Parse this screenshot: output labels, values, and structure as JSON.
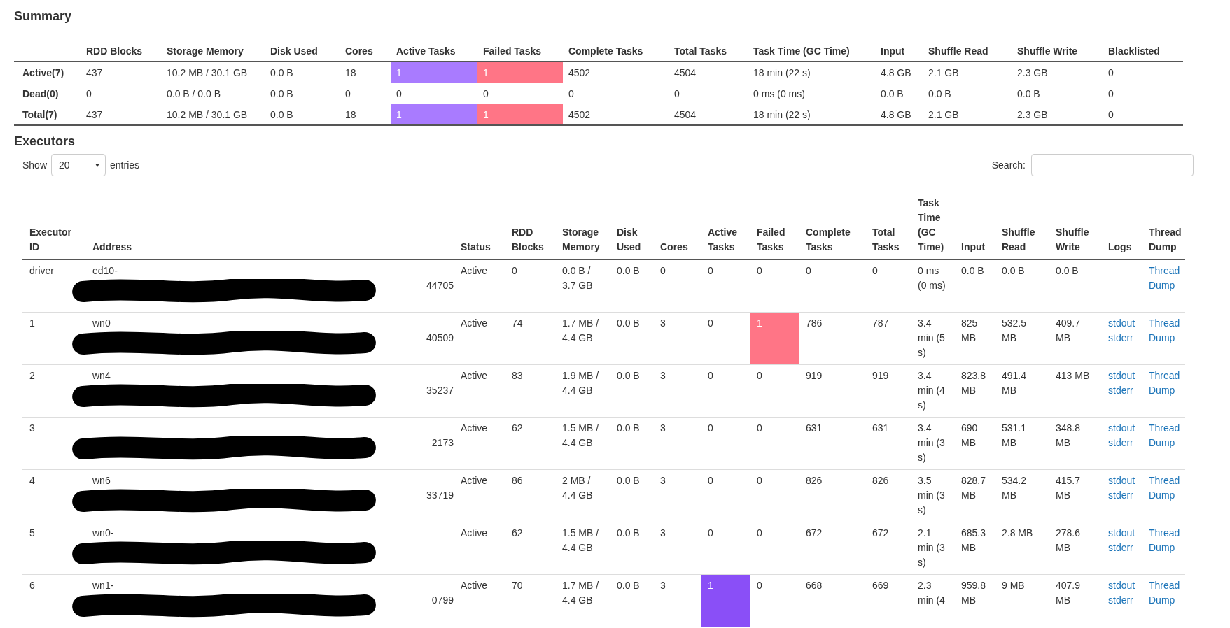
{
  "summary": {
    "title": "Summary",
    "columns": [
      "",
      "RDD Blocks",
      "Storage Memory",
      "Disk Used",
      "Cores",
      "Active Tasks",
      "Failed Tasks",
      "Complete Tasks",
      "Total Tasks",
      "Task Time (GC Time)",
      "Input",
      "Shuffle Read",
      "Shuffle Write",
      "Blacklisted"
    ],
    "rows": [
      {
        "cells": [
          {
            "kind": "label",
            "text": "Active(7)"
          },
          {
            "text": "437"
          },
          {
            "text": "10.2 MB / 30.1 GB"
          },
          {
            "text": "0.0 B"
          },
          {
            "text": "18"
          },
          {
            "text": "1",
            "color": "#a97bff"
          },
          {
            "text": "1",
            "color": "#ff7586"
          },
          {
            "text": "4502"
          },
          {
            "text": "4504"
          },
          {
            "text": "18 min (22 s)"
          },
          {
            "text": "4.8 GB"
          },
          {
            "text": "2.1 GB"
          },
          {
            "text": "2.3 GB"
          },
          {
            "text": "0"
          }
        ]
      },
      {
        "cells": [
          {
            "kind": "label",
            "text": "Dead(0)"
          },
          {
            "text": "0"
          },
          {
            "text": "0.0 B / 0.0 B"
          },
          {
            "text": "0.0 B"
          },
          {
            "text": "0"
          },
          {
            "text": "0"
          },
          {
            "text": "0"
          },
          {
            "text": "0"
          },
          {
            "text": "0"
          },
          {
            "text": "0 ms (0 ms)"
          },
          {
            "text": "0.0 B"
          },
          {
            "text": "0.0 B"
          },
          {
            "text": "0.0 B"
          },
          {
            "text": "0"
          }
        ]
      },
      {
        "cells": [
          {
            "kind": "label",
            "text": "Total(7)"
          },
          {
            "text": "437"
          },
          {
            "text": "10.2 MB / 30.1 GB"
          },
          {
            "text": "0.0 B"
          },
          {
            "text": "18"
          },
          {
            "text": "1",
            "color": "#a97bff"
          },
          {
            "text": "1",
            "color": "#ff7586"
          },
          {
            "text": "4502"
          },
          {
            "text": "4504"
          },
          {
            "text": "18 min (22 s)"
          },
          {
            "text": "4.8 GB"
          },
          {
            "text": "2.1 GB"
          },
          {
            "text": "2.3 GB"
          },
          {
            "text": "0"
          }
        ]
      }
    ]
  },
  "executors": {
    "title": "Executors",
    "show_label": "Show",
    "page_size": "20",
    "entries_label": "entries",
    "search_label": "Search:",
    "columns": [
      "Executor ID",
      "Address",
      "Status",
      "RDD Blocks",
      "Storage Memory",
      "Disk Used",
      "Cores",
      "Active Tasks",
      "Failed Tasks",
      "Complete Tasks",
      "Total Tasks",
      "Task Time (GC Time)",
      "Input",
      "Shuffle Read",
      "Shuffle Write",
      "Logs",
      "Thread Dump"
    ],
    "rows": [
      {
        "cells": [
          {
            "text": "driver"
          },
          {
            "kind": "address",
            "start": "ed10-",
            "end": "44705"
          },
          {
            "text": "Active"
          },
          {
            "text": "0"
          },
          {
            "text": "0.0 B / 3.7 GB"
          },
          {
            "text": "0.0 B"
          },
          {
            "text": "0"
          },
          {
            "text": "0"
          },
          {
            "text": "0"
          },
          {
            "text": "0"
          },
          {
            "text": "0"
          },
          {
            "text": "0 ms (0 ms)"
          },
          {
            "text": "0.0 B"
          },
          {
            "text": "0.0 B"
          },
          {
            "text": "0.0 B"
          },
          {
            "kind": "links"
          },
          {
            "kind": "link",
            "text": "Thread Dump"
          }
        ]
      },
      {
        "cells": [
          {
            "text": "1"
          },
          {
            "kind": "address",
            "start": "wn0",
            "end": "40509"
          },
          {
            "text": "Active"
          },
          {
            "text": "74"
          },
          {
            "text": "1.7 MB / 4.4 GB"
          },
          {
            "text": "0.0 B"
          },
          {
            "text": "3"
          },
          {
            "text": "0"
          },
          {
            "text": "1",
            "color": "#ff7586"
          },
          {
            "text": "786"
          },
          {
            "text": "787"
          },
          {
            "text": "3.4 min (5 s)"
          },
          {
            "text": "825 MB"
          },
          {
            "text": "532.5 MB"
          },
          {
            "text": "409.7 MB"
          },
          {
            "kind": "links",
            "links": [
              "stdout",
              "stderr"
            ]
          },
          {
            "kind": "link",
            "text": "Thread Dump"
          }
        ]
      },
      {
        "cells": [
          {
            "text": "2"
          },
          {
            "kind": "address",
            "start": "wn4",
            "end": "35237"
          },
          {
            "text": "Active"
          },
          {
            "text": "83"
          },
          {
            "text": "1.9 MB / 4.4 GB"
          },
          {
            "text": "0.0 B"
          },
          {
            "text": "3"
          },
          {
            "text": "0"
          },
          {
            "text": "0"
          },
          {
            "text": "919"
          },
          {
            "text": "919"
          },
          {
            "text": "3.4 min (4 s)"
          },
          {
            "text": "823.8 MB"
          },
          {
            "text": "491.4 MB"
          },
          {
            "text": "413 MB"
          },
          {
            "kind": "links",
            "links": [
              "stdout",
              "stderr"
            ]
          },
          {
            "kind": "link",
            "text": "Thread Dump"
          }
        ]
      },
      {
        "cells": [
          {
            "text": "3"
          },
          {
            "kind": "address",
            "end": "2173"
          },
          {
            "text": "Active"
          },
          {
            "text": "62"
          },
          {
            "text": "1.5 MB / 4.4 GB"
          },
          {
            "text": "0.0 B"
          },
          {
            "text": "3"
          },
          {
            "text": "0"
          },
          {
            "text": "0"
          },
          {
            "text": "631"
          },
          {
            "text": "631"
          },
          {
            "text": "3.4 min (3 s)"
          },
          {
            "text": "690 MB"
          },
          {
            "text": "531.1 MB"
          },
          {
            "text": "348.8 MB"
          },
          {
            "kind": "links",
            "links": [
              "stdout",
              "stderr"
            ]
          },
          {
            "kind": "link",
            "text": "Thread Dump"
          }
        ]
      },
      {
        "cells": [
          {
            "text": "4"
          },
          {
            "kind": "address",
            "start": "wn6",
            "end": "33719"
          },
          {
            "text": "Active"
          },
          {
            "text": "86"
          },
          {
            "text": "2 MB / 4.4 GB"
          },
          {
            "text": "0.0 B"
          },
          {
            "text": "3"
          },
          {
            "text": "0"
          },
          {
            "text": "0"
          },
          {
            "text": "826"
          },
          {
            "text": "826"
          },
          {
            "text": "3.5 min (3 s)"
          },
          {
            "text": "828.7 MB"
          },
          {
            "text": "534.2 MB"
          },
          {
            "text": "415.7 MB"
          },
          {
            "kind": "links",
            "links": [
              "stdout",
              "stderr"
            ]
          },
          {
            "kind": "link",
            "text": "Thread Dump"
          }
        ]
      },
      {
        "cells": [
          {
            "text": "5"
          },
          {
            "kind": "address",
            "start": "wn0-"
          },
          {
            "text": "Active"
          },
          {
            "text": "62"
          },
          {
            "text": "1.5 MB / 4.4 GB"
          },
          {
            "text": "0.0 B"
          },
          {
            "text": "3"
          },
          {
            "text": "0"
          },
          {
            "text": "0"
          },
          {
            "text": "672"
          },
          {
            "text": "672"
          },
          {
            "text": "2.1 min (3 s)"
          },
          {
            "text": "685.3 MB"
          },
          {
            "text": "2.8 MB"
          },
          {
            "text": "278.6 MB"
          },
          {
            "kind": "links",
            "links": [
              "stdout",
              "stderr"
            ]
          },
          {
            "kind": "link",
            "text": "Thread Dump"
          }
        ]
      },
      {
        "cells": [
          {
            "text": "6"
          },
          {
            "kind": "address",
            "start": "wn1-",
            "end": "0799"
          },
          {
            "text": "Active"
          },
          {
            "text": "70"
          },
          {
            "text": "1.7 MB / 4.4 GB"
          },
          {
            "text": "0.0 B"
          },
          {
            "text": "3"
          },
          {
            "text": "1",
            "color": "#8a4ff7"
          },
          {
            "text": "0"
          },
          {
            "text": "668"
          },
          {
            "text": "669"
          },
          {
            "text": "2.3 min (4"
          },
          {
            "text": "959.8 MB"
          },
          {
            "text": "9 MB"
          },
          {
            "text": "407.9 MB"
          },
          {
            "kind": "links",
            "links": [
              "stdout",
              "stderr"
            ]
          },
          {
            "kind": "link",
            "text": "Thread Dump"
          }
        ]
      }
    ]
  }
}
